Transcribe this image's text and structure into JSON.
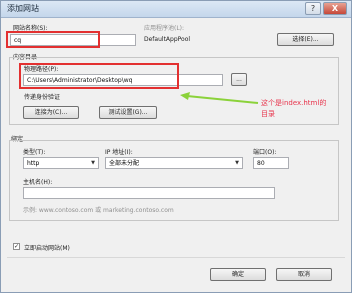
{
  "window": {
    "title": "添加网站",
    "help": "?",
    "close": "X"
  },
  "site_name": {
    "label": "网站名称(S):",
    "value": "cq"
  },
  "app_pool": {
    "label": "应用程序池(L):",
    "value": "DefaultAppPool",
    "select_button": "选择(E)..."
  },
  "content_directory": {
    "label": "内容目录",
    "physical_path": {
      "label": "物理路径(P):",
      "value": "C:\\Users\\Administrator\\Desktop\\wq",
      "browse_button": "..."
    },
    "pass_through": {
      "label": "传递身份验证",
      "connect_as_button": "连接为(C)...",
      "test_settings_button": "测试设置(G)..."
    }
  },
  "annotation": {
    "line1": "这个是index.html的",
    "line2": "目录"
  },
  "binding": {
    "label": "绑定",
    "type": {
      "label": "类型(T):",
      "value": "http"
    },
    "ip": {
      "label": "IP 地址(I):",
      "value": "全部未分配"
    },
    "port": {
      "label": "端口(O):",
      "value": "80"
    },
    "host_name": {
      "label": "主机名(H):",
      "value": ""
    },
    "example": "示例: www.contoso.com 或 marketing.contoso.com"
  },
  "start_immediately": {
    "label": "立即启动网站(M)",
    "checked": true
  },
  "footer": {
    "ok": "确定",
    "cancel": "取消"
  },
  "colors": {
    "highlight_box": "#e33030",
    "annotation": "#e8344c",
    "arrow": "#8bd23a"
  }
}
